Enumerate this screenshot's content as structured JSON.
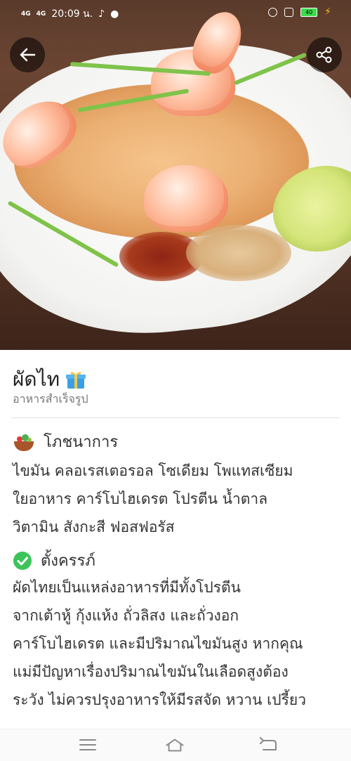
{
  "status_bar": {
    "signal_1": "4G",
    "signal_2": "4G",
    "time": "20:09 น.",
    "battery": "40"
  },
  "header": {
    "back_icon": "arrow-left-icon",
    "share_icon": "share-icon"
  },
  "dish": {
    "title": "ผัดไท",
    "badge_icon": "gift-icon",
    "subtitle": "อาหารสำเร็จรูป"
  },
  "nutrition": {
    "heading": "โภชนาการ",
    "icon": "salad-bowl-icon",
    "lines": [
      "ไขมัน คลอเรสเตอรอล โซเดียม โพแทสเซียม",
      "ใยอาหาร คาร์โบไฮเดรต โปรตีน น้ำตาล",
      "วิตามิน สังกะสี ฟอสฟอรัส"
    ]
  },
  "pregnancy": {
    "heading": "ตั้งครรภ์",
    "icon": "check-circle-icon",
    "lines": [
      "ผัดไทยเป็นแหล่งอาหารที่มีทั้งโปรตีน",
      "จากเต้าหู้ กุ้งแห้ง ถั่วลิสง และถั่วงอก",
      "คาร์โบไฮเดรต และมีปริมาณไขมันสูง หากคุณ",
      "แม่มีปัญหาเรื่องปริมาณไขมันในเลือดสูงต้อง",
      "ระวัง ไม่ควรปรุงอาหารให้มีรสจัด หวาน เปรี้ยว"
    ]
  },
  "navbar": {
    "menu_icon": "menu-icon",
    "home_icon": "home-icon",
    "back_icon": "back-icon"
  },
  "colors": {
    "check_green": "#3cc35a",
    "gift_blue": "#3aa0e6"
  }
}
